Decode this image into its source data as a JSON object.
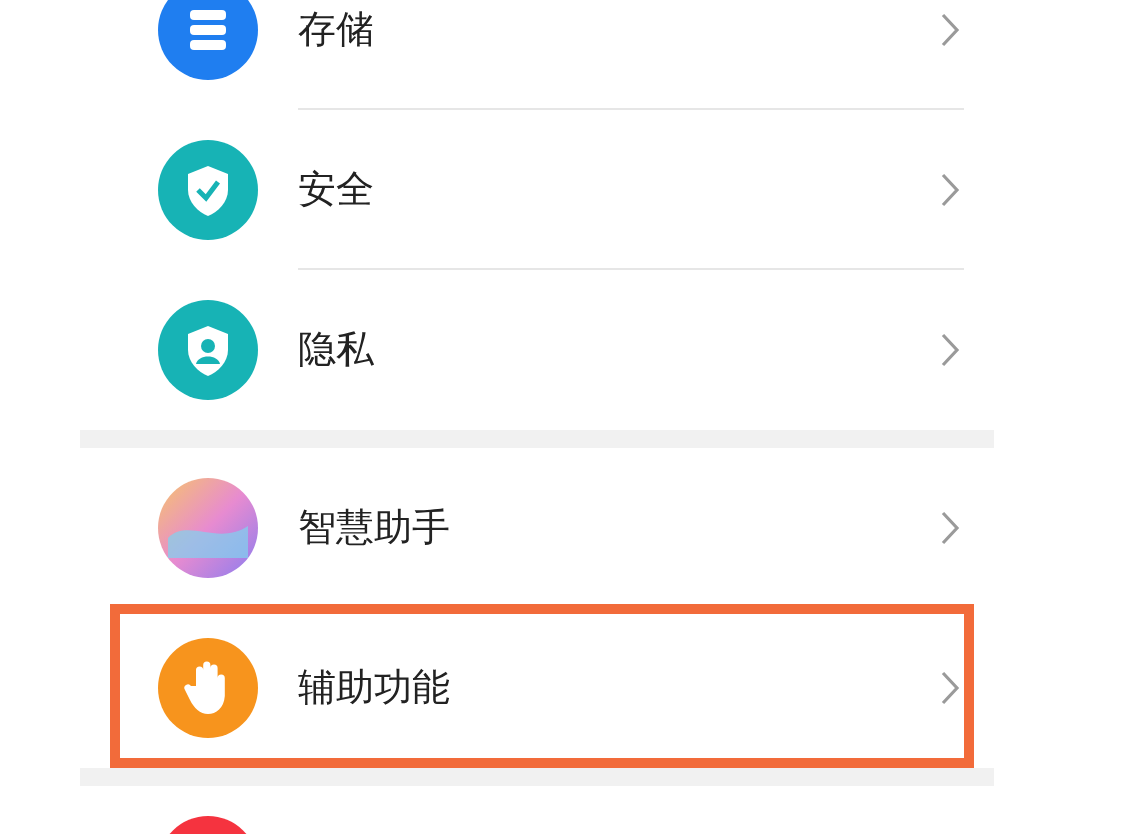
{
  "sections": [
    {
      "items": [
        {
          "label": "存储",
          "highlighted": false
        },
        {
          "label": "安全",
          "highlighted": false
        },
        {
          "label": "隐私",
          "highlighted": false
        }
      ]
    },
    {
      "items": [
        {
          "label": "智慧助手",
          "highlighted": false
        },
        {
          "label": "辅助功能",
          "highlighted": true
        }
      ]
    },
    {
      "items": [
        {
          "highlighted": false
        }
      ]
    }
  ]
}
